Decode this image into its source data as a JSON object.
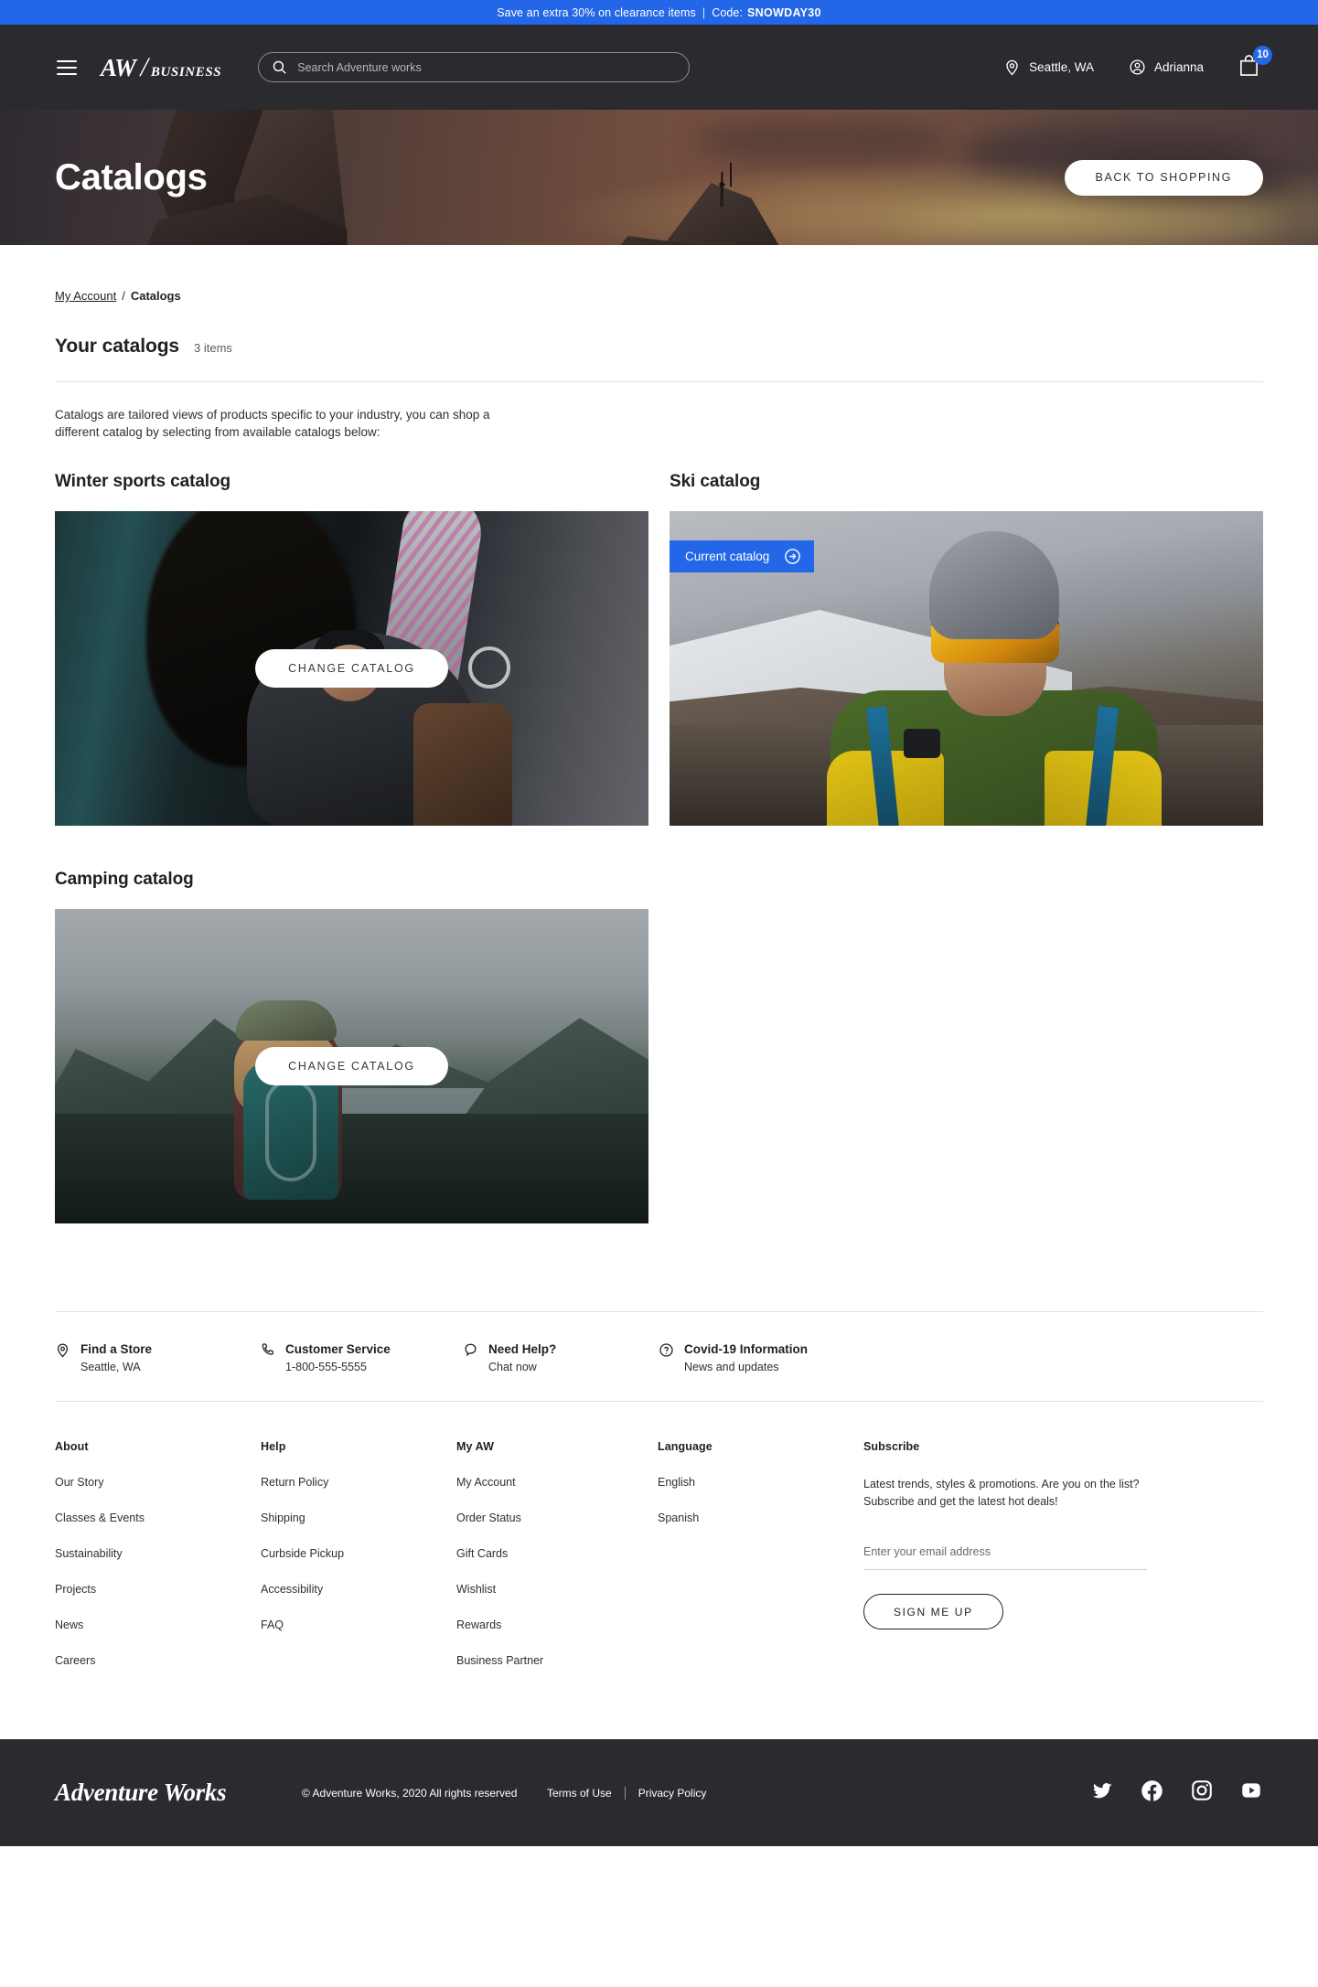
{
  "promo": {
    "text": "Save an extra 30% on clearance items",
    "separator": "|",
    "code_label": "Code:",
    "code": "SNOWDAY30",
    "bg_color": "#2367e8"
  },
  "header": {
    "menu_icon": "hamburger-menu-icon",
    "logo_primary": "AW",
    "logo_slash": "/",
    "logo_secondary": "BUSINESS",
    "search": {
      "icon": "search-icon",
      "placeholder": "Search Adventure works",
      "value": ""
    },
    "location": {
      "icon": "location-pin-icon",
      "label": "Seattle, WA"
    },
    "account": {
      "icon": "user-circle-icon",
      "label": "Adrianna"
    },
    "cart": {
      "icon": "shopping-bag-icon",
      "count": "10",
      "badge_color": "#2367e8"
    },
    "bg_color": "#2b2a2e"
  },
  "hero": {
    "title": "Catalogs",
    "back_button": "BACK TO SHOPPING"
  },
  "breadcrumb": {
    "parent": "My Account",
    "separator": "/",
    "current": "Catalogs"
  },
  "section": {
    "title": "Your catalogs",
    "count": "3 items",
    "description": "Catalogs are tailored views of products specific to your industry, you can shop a different catalog by selecting from available catalogs below:"
  },
  "catalogs": [
    {
      "name": "Winter sports catalog",
      "button": "CHANGE CATALOG",
      "is_current": false
    },
    {
      "name": "Ski catalog",
      "current_label": "Current catalog",
      "current_icon": "arrow-right-circle-icon",
      "is_current": true,
      "badge_color": "#2367e8"
    },
    {
      "name": "Camping catalog",
      "button": "CHANGE CATALOG",
      "is_current": false
    }
  ],
  "services": [
    {
      "icon": "location-pin-icon",
      "title": "Find a Store",
      "sub": "Seattle, WA"
    },
    {
      "icon": "phone-icon",
      "title": "Customer Service",
      "sub": "1-800-555-5555"
    },
    {
      "icon": "chat-bubble-icon",
      "title": "Need Help?",
      "sub": "Chat now"
    },
    {
      "icon": "question-circle-icon",
      "title": "Covid-19 Information",
      "sub": "News and updates"
    }
  ],
  "footer": {
    "about": {
      "heading": "About",
      "links": [
        "Our Story",
        "Classes & Events",
        "Sustainability",
        "Projects",
        "News",
        "Careers"
      ]
    },
    "help": {
      "heading": "Help",
      "links": [
        "Return Policy",
        "Shipping",
        "Curbside Pickup",
        "Accessibility",
        "FAQ"
      ]
    },
    "myaw": {
      "heading": "My AW",
      "links": [
        "My Account",
        "Order Status",
        "Gift Cards",
        "Wishlist",
        "Rewards",
        "Business Partner"
      ]
    },
    "language": {
      "heading": "Language",
      "links": [
        "English",
        "Spanish"
      ]
    },
    "subscribe": {
      "heading": "Subscribe",
      "line1": "Latest trends, styles & promotions. Are you on the list?",
      "line2": "Subscribe and get the latest hot deals!",
      "email_placeholder": "Enter your email address",
      "email_value": "",
      "button": "SIGN ME UP"
    }
  },
  "bottom": {
    "logo": "Adventure Works",
    "copyright": "© Adventure Works, 2020 All rights reserved",
    "terms": "Terms of Use",
    "privacy": "Privacy Policy",
    "social": [
      "twitter-icon",
      "facebook-icon",
      "instagram-icon",
      "youtube-icon"
    ],
    "bg_color": "#2b2a2e"
  }
}
